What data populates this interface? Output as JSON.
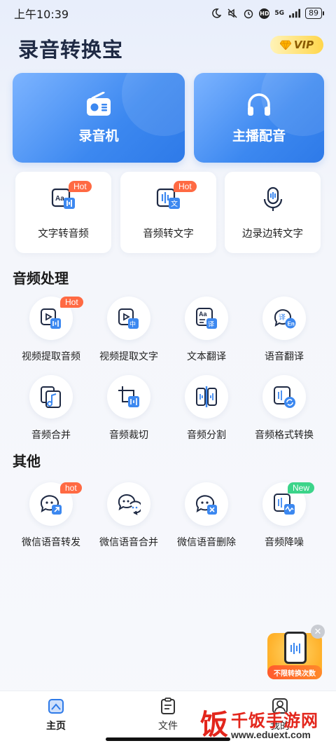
{
  "status_bar": {
    "time": "上午10:39",
    "network": "5G",
    "battery": "89"
  },
  "header": {
    "title": "录音转换宝",
    "vip_label": "VIP"
  },
  "main_cards": [
    {
      "label": "录音机",
      "icon": "radio-icon"
    },
    {
      "label": "主播配音",
      "icon": "headphones-icon"
    }
  ],
  "tool_cards": [
    {
      "label": "文字转音频",
      "badge": "Hot"
    },
    {
      "label": "音频转文字",
      "badge": "Hot"
    },
    {
      "label": "边录边转文字",
      "badge": ""
    }
  ],
  "audio_section": {
    "title": "音频处理",
    "items": [
      {
        "label": "视频提取音频",
        "badge": "Hot"
      },
      {
        "label": "视频提取文字",
        "badge": ""
      },
      {
        "label": "文本翻译",
        "badge": ""
      },
      {
        "label": "语音翻译",
        "badge": ""
      },
      {
        "label": "音频合并",
        "badge": ""
      },
      {
        "label": "音频裁切",
        "badge": ""
      },
      {
        "label": "音频分割",
        "badge": ""
      },
      {
        "label": "音频格式转换",
        "badge": ""
      }
    ]
  },
  "other_section": {
    "title": "其他",
    "items": [
      {
        "label": "微信语音转发",
        "badge": "hot"
      },
      {
        "label": "微信语音合并",
        "badge": ""
      },
      {
        "label": "微信语音删除",
        "badge": ""
      },
      {
        "label": "音频降噪",
        "badge": "New"
      }
    ]
  },
  "float_ad": {
    "label": "不限转换次数"
  },
  "tabbar": [
    {
      "label": "主页",
      "active": true
    },
    {
      "label": "文件",
      "active": false
    },
    {
      "label": "我的",
      "active": false
    }
  ],
  "watermark": {
    "logo": "饭",
    "title": "千饭手游网",
    "url": "www.eduext.com"
  },
  "colors": {
    "accent": "#3c88f0",
    "hot": "#ff6a43",
    "new": "#3cd48a",
    "vip": "#ffd64b"
  }
}
